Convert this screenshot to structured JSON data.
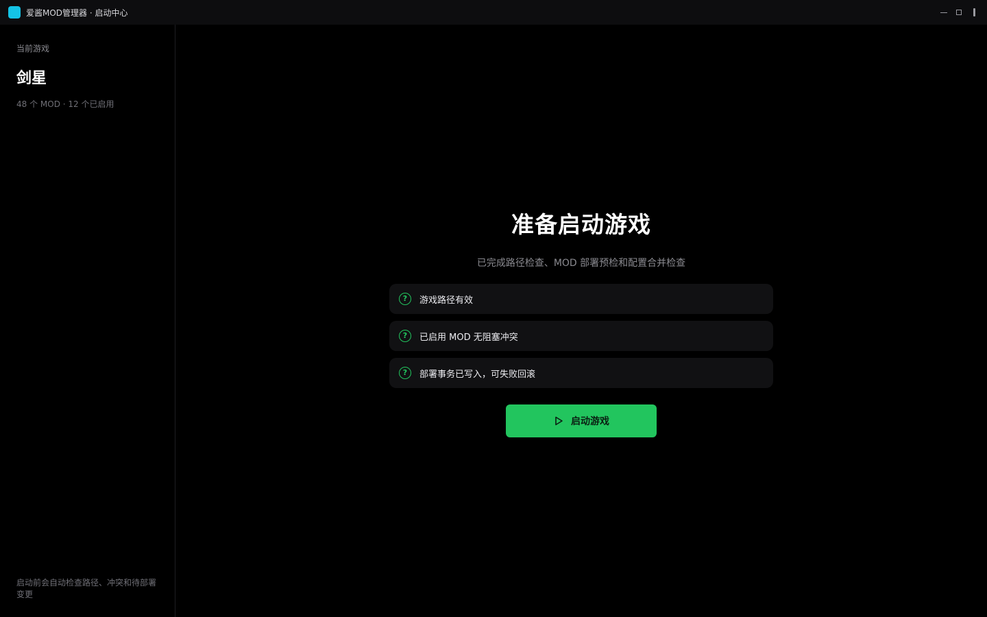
{
  "titlebar": {
    "title": "爱酱MOD管理器 · 启动中心",
    "icon": "app-icon",
    "accent": "#14c3e6"
  },
  "sidebar": {
    "label": "当前游戏",
    "game_name": "剑星",
    "stats": "48 个 MOD · 12 个已启用",
    "footer": "启动前会自动检查路径、冲突和待部署变更"
  },
  "main": {
    "headline": "准备启动游戏",
    "subline": "已完成路径检查、MOD 部署预检和配置合并检查",
    "checks": [
      {
        "icon": "question-circle-icon",
        "text": "游戏路径有效"
      },
      {
        "icon": "question-circle-icon",
        "text": "已启用 MOD 无阻塞冲突"
      },
      {
        "icon": "question-circle-icon",
        "text": "部署事务已写入，可失败回滚"
      }
    ],
    "launch_button": {
      "icon": "play-icon",
      "label": "启动游戏",
      "color": "#22c55e"
    }
  }
}
